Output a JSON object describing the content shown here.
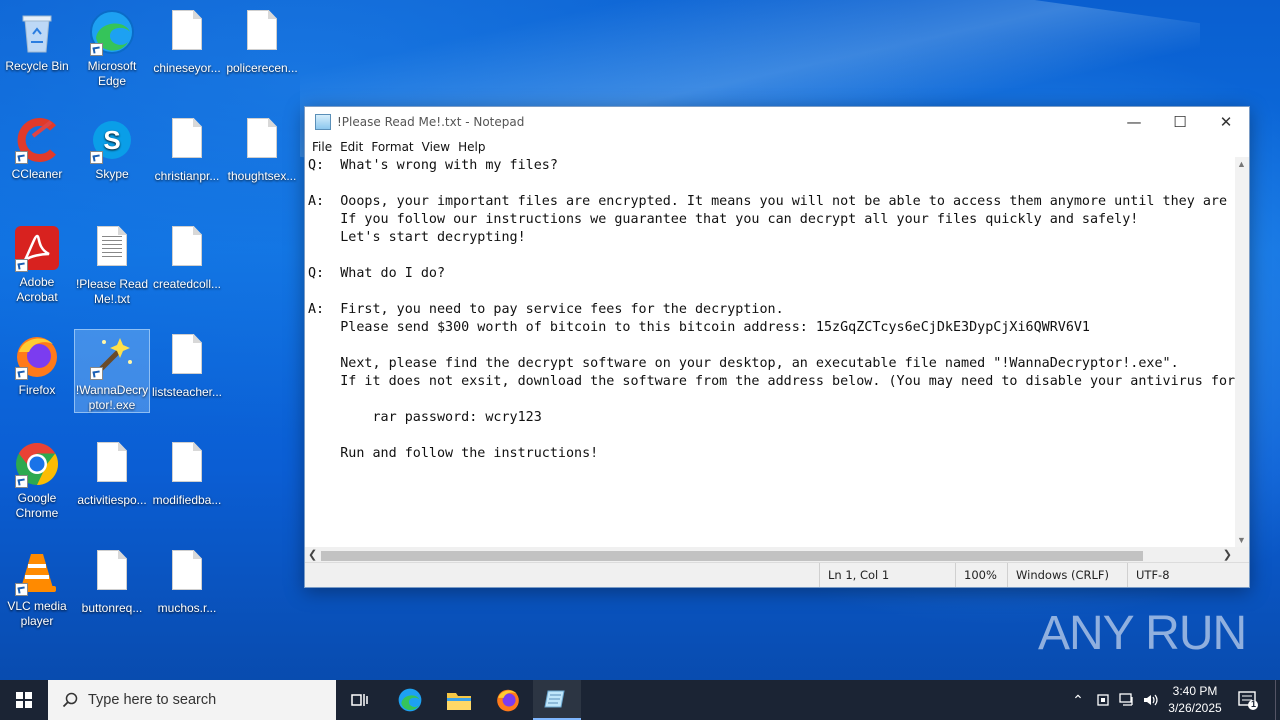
{
  "desktop": {
    "icons": [
      {
        "label": "Recycle Bin"
      },
      {
        "label": "Microsoft Edge"
      },
      {
        "label": "chineseyor..."
      },
      {
        "label": "policerecen..."
      },
      {
        "label": "CCleaner"
      },
      {
        "label": "Skype"
      },
      {
        "label": "christianpr..."
      },
      {
        "label": "thoughtsex..."
      },
      {
        "label": "Adobe Acrobat"
      },
      {
        "label": "!Please Read Me!.txt"
      },
      {
        "label": "createdcoll..."
      },
      {
        "label": "Firefox"
      },
      {
        "label": "!WannaDecryptor!.exe"
      },
      {
        "label": "liststeacher..."
      },
      {
        "label": "Google Chrome"
      },
      {
        "label": "activitiespo..."
      },
      {
        "label": "modifiedba..."
      },
      {
        "label": "VLC media player"
      },
      {
        "label": "buttonreq..."
      },
      {
        "label": "muchos.r..."
      }
    ]
  },
  "notepad": {
    "title": "!Please Read Me!.txt - Notepad",
    "menu": [
      "File",
      "Edit",
      "Format",
      "View",
      "Help"
    ],
    "lines": [
      "Q:  What's wrong with my files?",
      "",
      "A:  Ooops, your important files are encrypted. It means you will not be able to access them anymore until they are",
      "    If you follow our instructions we guarantee that you can decrypt all your files quickly and safely!",
      "    Let's start decrypting!",
      "",
      "Q:  What do I do?",
      "",
      "A:  First, you need to pay service fees for the decryption.",
      "    Please send $300 worth of bitcoin to this bitcoin address: 15zGqZCTcys6eCjDkE3DypCjXi6QWRV6V1",
      "",
      "    Next, please find the decrypt software on your desktop, an executable file named \"!WannaDecryptor!.exe\".",
      "    If it does not exsit, download the software from the address below. (You may need to disable your antivirus for",
      "",
      "        rar password: wcry123",
      "",
      "    Run and follow the instructions!"
    ],
    "status": {
      "position": "Ln 1, Col 1",
      "zoom": "100%",
      "line_endings": "Windows (CRLF)",
      "encoding": "UTF-8"
    }
  },
  "taskbar": {
    "search_placeholder": "Type here to search",
    "time": "3:40 PM",
    "date": "3/26/2025",
    "notification_count": "1"
  },
  "watermark": "ANY RUN"
}
